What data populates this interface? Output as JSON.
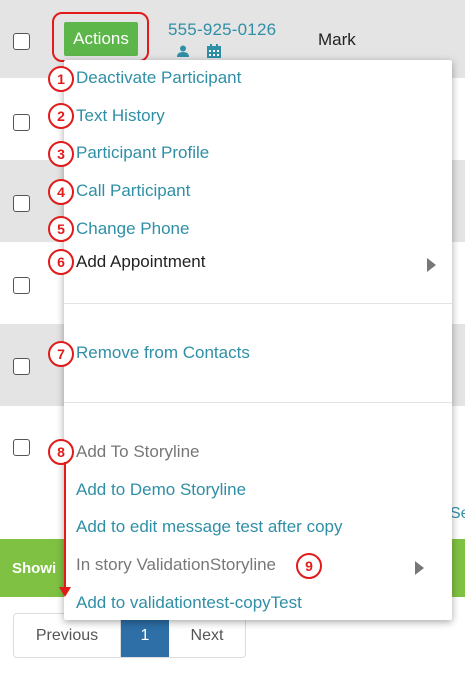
{
  "table": {
    "row1": {
      "actions_label": "Actions",
      "phone": "555-925-0126",
      "name": "Mark"
    }
  },
  "footer": {
    "showing_text": "Showi",
    "partial_link": "Se"
  },
  "pagination": {
    "previous": "Previous",
    "current": "1",
    "next": "Next"
  },
  "menu": {
    "items": [
      {
        "label": "Deactivate Participant",
        "badge": "1"
      },
      {
        "label": "Text History",
        "badge": "2"
      },
      {
        "label": "Participant Profile",
        "badge": "3"
      },
      {
        "label": "Call Participant",
        "badge": "4"
      },
      {
        "label": "Change Phone",
        "badge": "5"
      },
      {
        "label": "Add Appointment",
        "badge": "6"
      },
      {
        "label": "Remove from Contacts",
        "badge": "7"
      },
      {
        "label": "Add To Storyline",
        "badge": "8"
      },
      {
        "label": "Add to Demo Storyline"
      },
      {
        "label": "Add to edit message test after copy"
      },
      {
        "label": "In story ValidationStoryline",
        "badge": "9"
      },
      {
        "label": "Add to validationtest-copyTest"
      }
    ]
  },
  "colors": {
    "accent": "#2f8fa6",
    "button_green": "#5db64a",
    "annotation_red": "#e21a1a",
    "page_active": "#2d6fa6"
  }
}
